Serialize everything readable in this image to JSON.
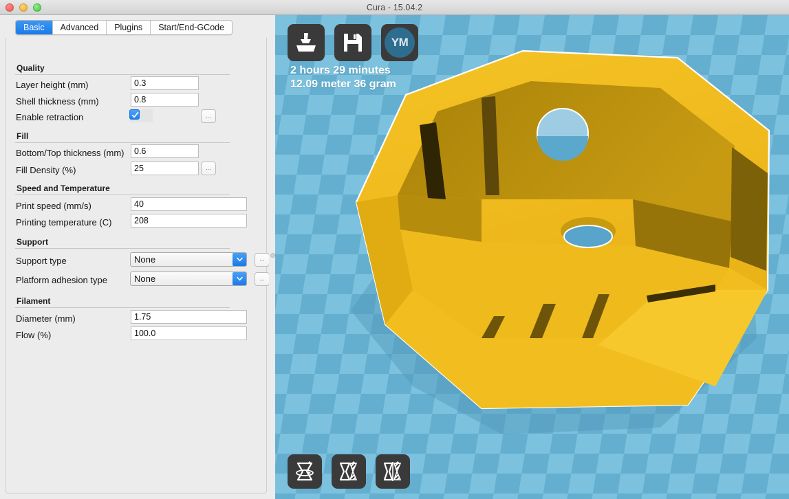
{
  "window": {
    "title": "Cura - 15.04.2",
    "controls": [
      "close",
      "minimize",
      "maximize"
    ]
  },
  "tabs": [
    {
      "label": "Basic",
      "active": true
    },
    {
      "label": "Advanced",
      "active": false
    },
    {
      "label": "Plugins",
      "active": false
    },
    {
      "label": "Start/End-GCode",
      "active": false
    }
  ],
  "sections": {
    "quality": {
      "header": "Quality",
      "layer_height_label": "Layer height (mm)",
      "layer_height_value": "0.3",
      "shell_thickness_label": "Shell thickness (mm)",
      "shell_thickness_value": "0.8",
      "enable_retraction_label": "Enable retraction",
      "enable_retraction_checked": true,
      "retraction_more": "..."
    },
    "fill": {
      "header": "Fill",
      "bottom_top_label": "Bottom/Top thickness (mm)",
      "bottom_top_value": "0.6",
      "fill_density_label": "Fill Density (%)",
      "fill_density_value": "25",
      "fill_more": "..."
    },
    "speed_temp": {
      "header": "Speed and Temperature",
      "print_speed_label": "Print speed (mm/s)",
      "print_speed_value": "40",
      "printing_temp_label": "Printing temperature (C)",
      "printing_temp_value": "208"
    },
    "support": {
      "header": "Support",
      "support_type_label": "Support type",
      "support_type_value": "None",
      "support_more": "...",
      "platform_adhesion_label": "Platform adhesion type",
      "platform_adhesion_value": "None",
      "adhesion_more": "..."
    },
    "filament": {
      "header": "Filament",
      "diameter_label": "Diameter (mm)",
      "diameter_value": "1.75",
      "flow_label": "Flow (%)",
      "flow_value": "100.0"
    }
  },
  "viewport": {
    "top_tools": [
      {
        "name": "load-model-button",
        "icon": "printer-icon"
      },
      {
        "name": "save-toolpath-button",
        "icon": "floppy-disk-icon"
      },
      {
        "name": "youmagine-button",
        "icon": "ym-icon",
        "label": "YM"
      }
    ],
    "print_time": "2 hours 29 minutes",
    "print_material": "12.09 meter 36 gram",
    "bottom_tools": [
      {
        "name": "rotate-button",
        "icon": "rotate-icon"
      },
      {
        "name": "scale-button",
        "icon": "scale-icon"
      },
      {
        "name": "mirror-button",
        "icon": "mirror-icon"
      }
    ]
  },
  "colors": {
    "accent_blue": "#1a7ae8",
    "platform_light": "#7fc2df",
    "platform_dark": "#63aece",
    "model_gold": "#f0b81c",
    "model_shade": "#c79611",
    "toolbar_dark": "#3a3a3a"
  }
}
